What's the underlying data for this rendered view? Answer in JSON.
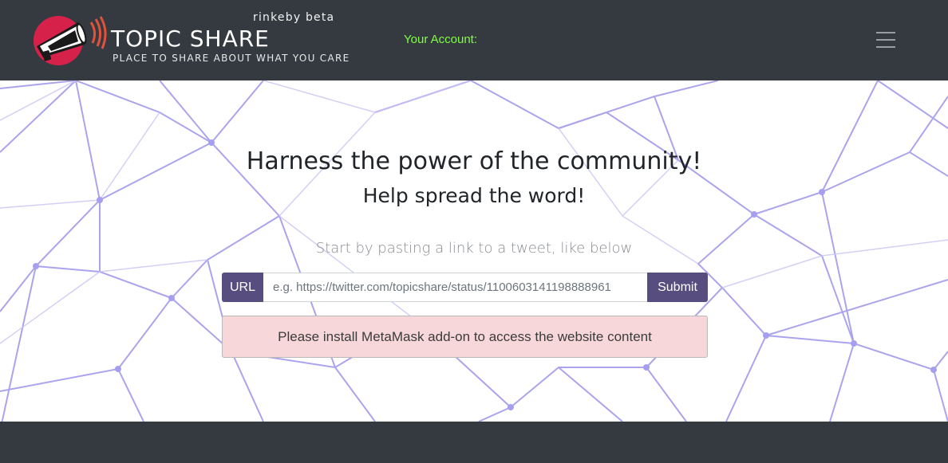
{
  "header": {
    "brand_title": "TOPIC SHARE",
    "brand_beta": "rinkeby beta",
    "brand_tagline": "PLACE TO SHARE ABOUT WHAT YOU CARE",
    "account_label": "Your Account:",
    "menu_icon": "hamburger-menu-icon",
    "logo_icon": "megaphone-icon"
  },
  "hero": {
    "heading": "Harness the power of the community!",
    "subheading": "Help spread the word!",
    "hint": "Start by pasting a link to a tweet, like below",
    "url_label": "URL",
    "url_placeholder": "e.g. https://twitter.com/topicshare/status/1100603141198888961",
    "submit_label": "Submit",
    "alert": "Please install MetaMask add-on to access the website content"
  },
  "colors": {
    "navbar": "#343a40",
    "accent": "#574e7f",
    "account_text": "#7fff3f",
    "logo_red": "#d6224a",
    "alert_bg": "#f8d7da",
    "network_lines": "#8f86e8"
  }
}
